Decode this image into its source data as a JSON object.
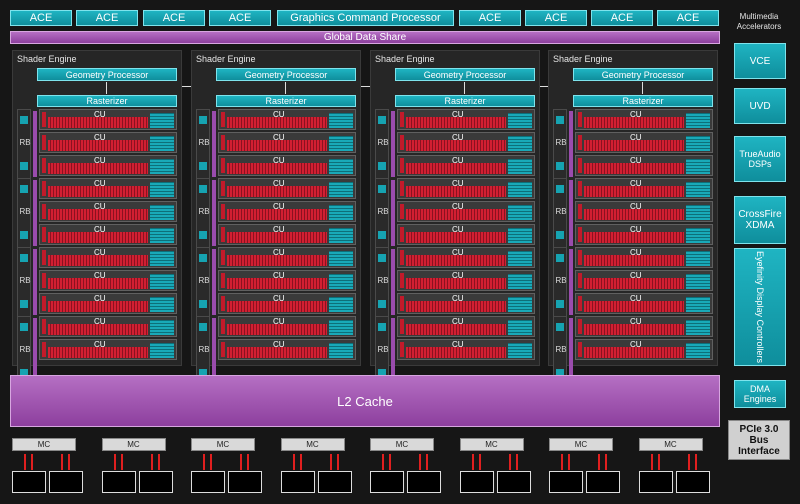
{
  "top_bar": {
    "ace_left": [
      "ACE",
      "ACE",
      "ACE",
      "ACE"
    ],
    "gcp_label": "Graphics Command Processor",
    "ace_right": [
      "ACE",
      "ACE",
      "ACE",
      "ACE"
    ]
  },
  "gds_label": "Global Data Share",
  "shader_engines": [
    {
      "title": "Shader Engine",
      "geometry": "Geometry Processor",
      "rasterizer": "Rasterizer"
    },
    {
      "title": "Shader Engine",
      "geometry": "Geometry Processor",
      "rasterizer": "Rasterizer"
    },
    {
      "title": "Shader Engine",
      "geometry": "Geometry Processor",
      "rasterizer": "Rasterizer"
    },
    {
      "title": "Shader Engine",
      "geometry": "Geometry Processor",
      "rasterizer": "Rasterizer"
    }
  ],
  "cu_label": "CU",
  "rb_label": "RB",
  "multimedia": {
    "heading": "Multimedia Accelerators",
    "vce": "VCE",
    "uvd": "UVD",
    "trueaudio": "TrueAudio DSPs",
    "crossfire": "CrossFire XDMA",
    "eyefinity": "Eyefinity Display Controllers",
    "dma": "DMA Engines",
    "pcie": "PCIe 3.0 Bus Interface"
  },
  "l2_label": "L2 Cache",
  "mc_labels": [
    "MC",
    "MC",
    "MC",
    "MC",
    "MC",
    "MC",
    "MC",
    "MC"
  ]
}
